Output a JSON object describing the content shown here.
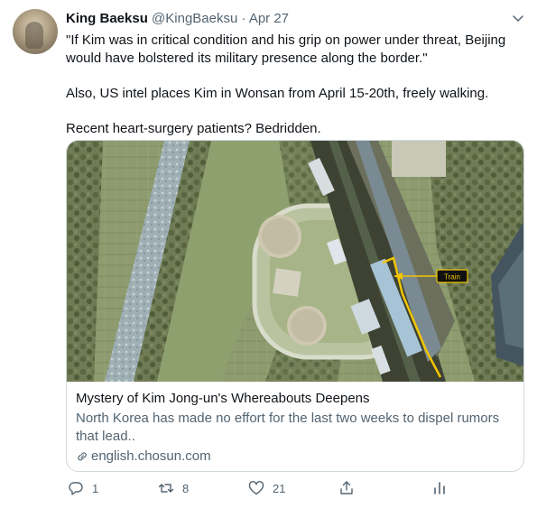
{
  "tweet": {
    "author_name": "King Baeksu",
    "handle": "@KingBaeksu",
    "separator": "·",
    "date": "Apr 27",
    "paragraphs": [
      "\"If Kim was in critical condition and his grip on power under threat, Beijing would have bolstered its military presence along the border.\"",
      "Also, US intel places Kim in Wonsan from April 15-20th, freely walking.",
      "Recent heart-surgery patients? Bedridden."
    ]
  },
  "card": {
    "image_label": "Train",
    "title": "Mystery of Kim Jong-un's Whereabouts Deepens",
    "description": "North Korea has made no effort for the last two weeks to dispel rumors that lead..",
    "link": "english.chosun.com"
  },
  "actions": {
    "reply_count": "1",
    "retweet_count": "8",
    "like_count": "21"
  },
  "icons": [
    "chevron-down-icon",
    "reply-icon",
    "retweet-icon",
    "like-icon",
    "share-icon",
    "analytics-icon",
    "link-icon"
  ],
  "colors": {
    "text": "#0f1419",
    "muted": "#536471",
    "border": "#cfd9de",
    "train_marker": "#f2c500"
  }
}
